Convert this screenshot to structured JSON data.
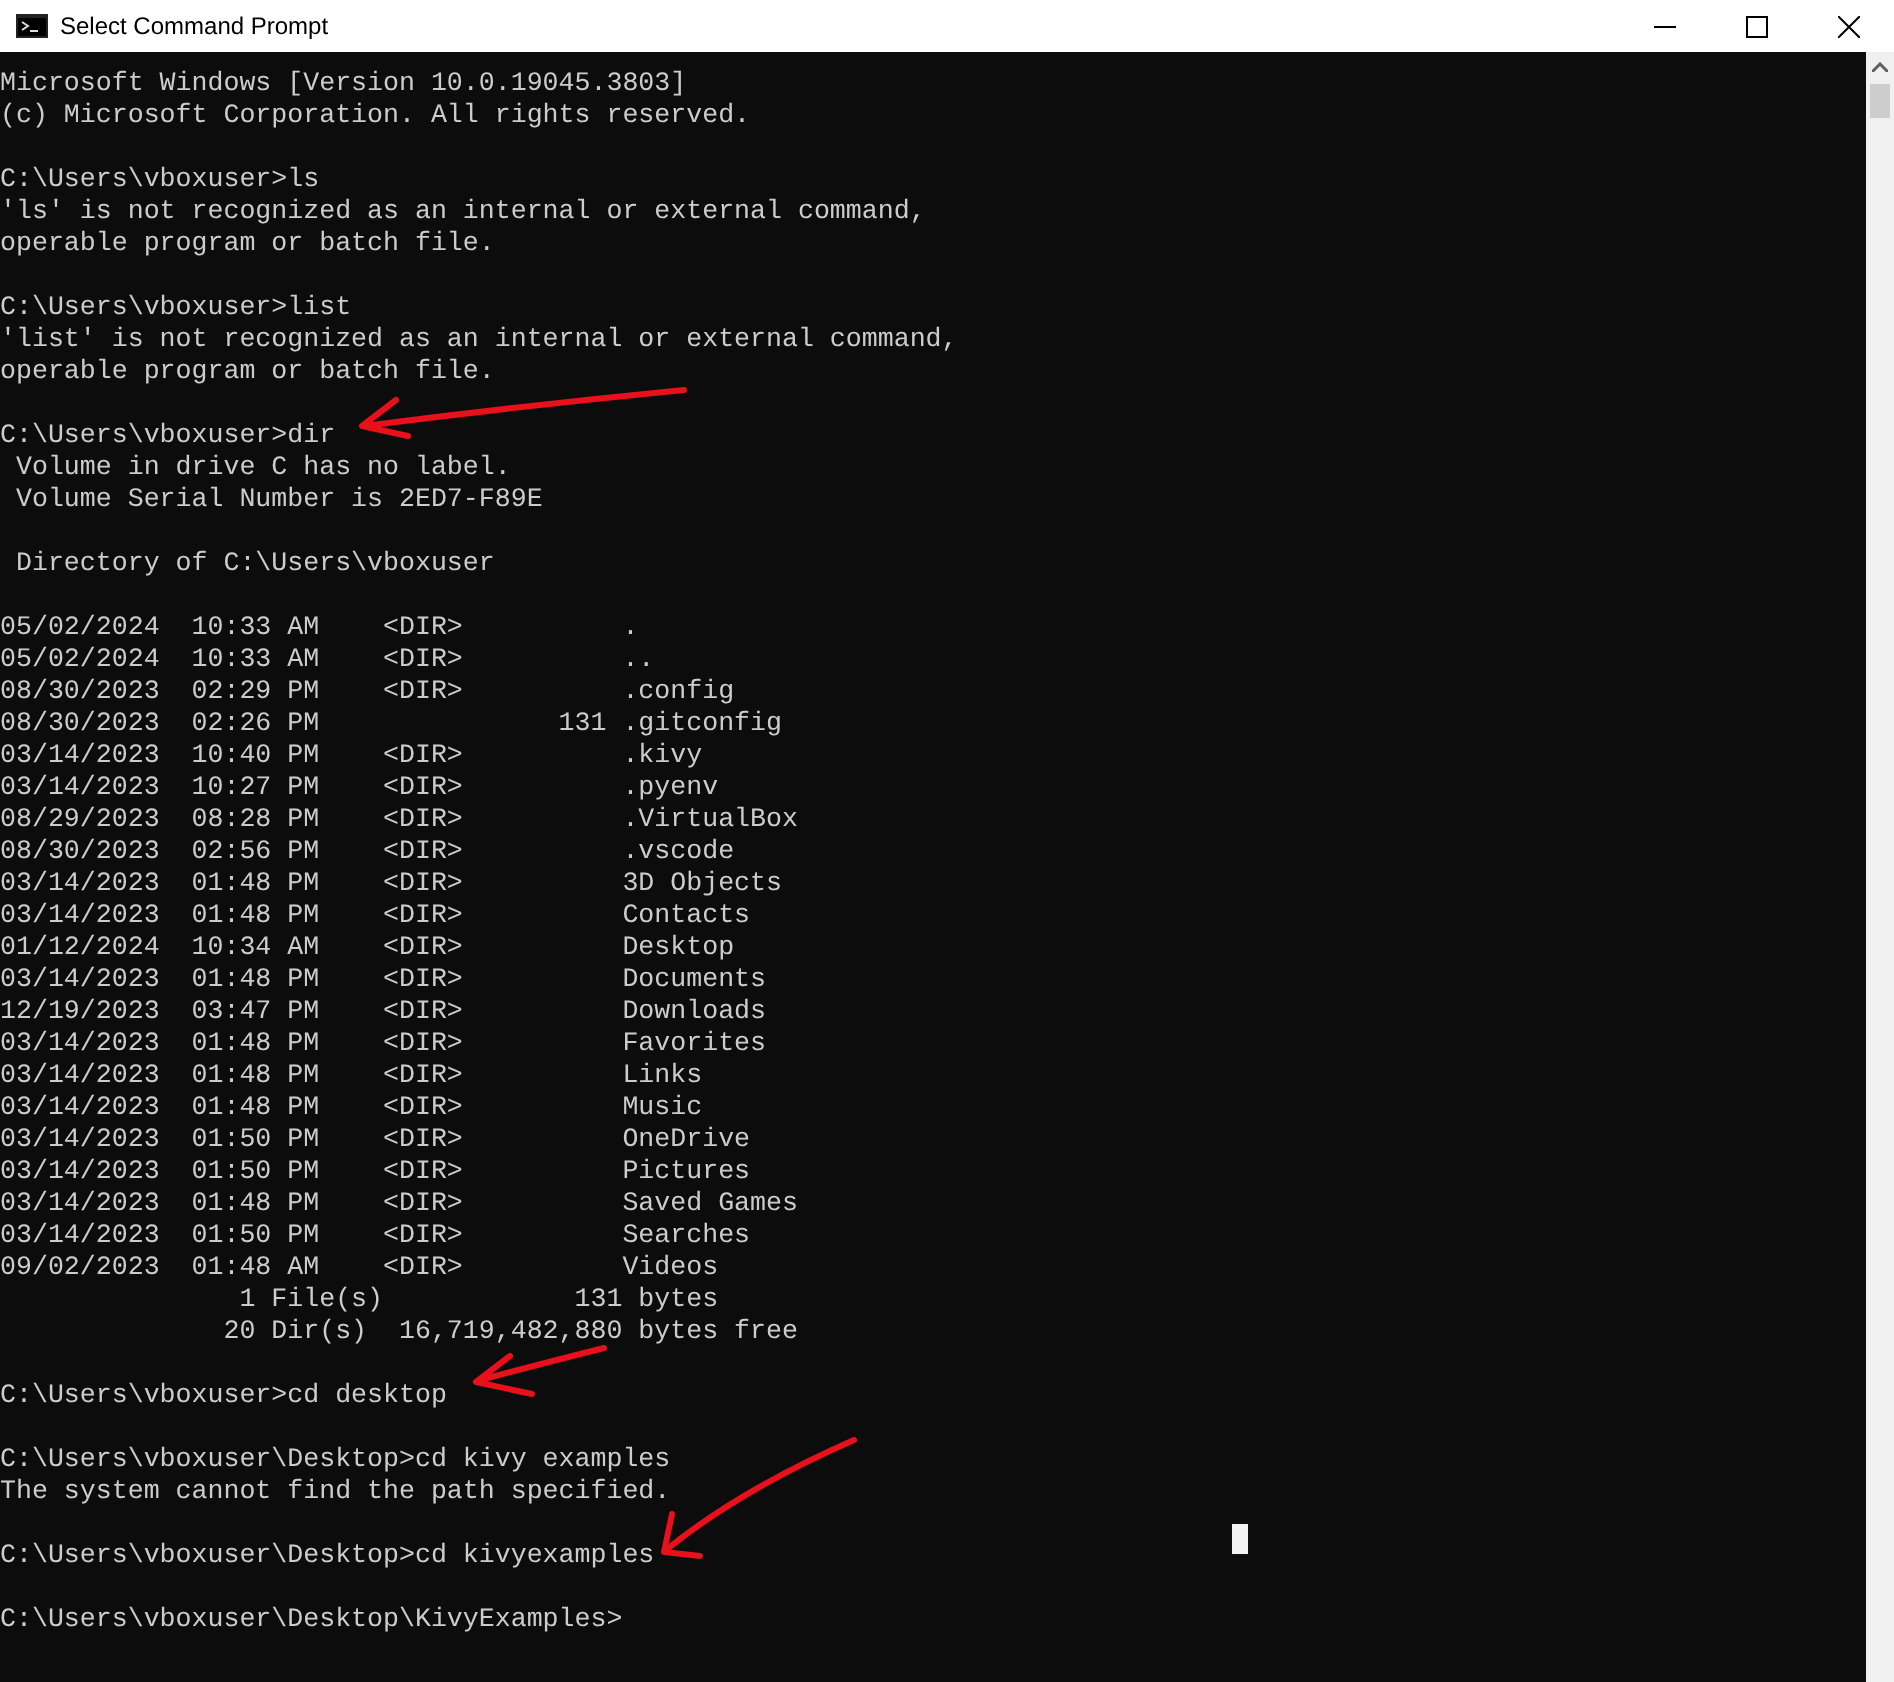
{
  "window": {
    "title": "Select Command Prompt"
  },
  "console": {
    "blocks": [
      [
        "Microsoft Windows [Version 10.0.19045.3803]",
        "(c) Microsoft Corporation. All rights reserved."
      ],
      [
        "C:\\Users\\vboxuser>ls",
        "'ls' is not recognized as an internal or external command,",
        "operable program or batch file."
      ],
      [
        "C:\\Users\\vboxuser>list",
        "'list' is not recognized as an internal or external command,",
        "operable program or batch file."
      ],
      [
        "C:\\Users\\vboxuser>dir",
        " Volume in drive C has no label.",
        " Volume Serial Number is 2ED7-F89E"
      ],
      [
        " Directory of C:\\Users\\vboxuser"
      ],
      [
        "05/02/2024  10:33 AM    <DIR>          .",
        "05/02/2024  10:33 AM    <DIR>          ..",
        "08/30/2023  02:29 PM    <DIR>          .config",
        "08/30/2023  02:26 PM               131 .gitconfig",
        "03/14/2023  10:40 PM    <DIR>          .kivy",
        "03/14/2023  10:27 PM    <DIR>          .pyenv",
        "08/29/2023  08:28 PM    <DIR>          .VirtualBox",
        "08/30/2023  02:56 PM    <DIR>          .vscode",
        "03/14/2023  01:48 PM    <DIR>          3D Objects",
        "03/14/2023  01:48 PM    <DIR>          Contacts",
        "01/12/2024  10:34 AM    <DIR>          Desktop",
        "03/14/2023  01:48 PM    <DIR>          Documents",
        "12/19/2023  03:47 PM    <DIR>          Downloads",
        "03/14/2023  01:48 PM    <DIR>          Favorites",
        "03/14/2023  01:48 PM    <DIR>          Links",
        "03/14/2023  01:48 PM    <DIR>          Music",
        "03/14/2023  01:50 PM    <DIR>          OneDrive",
        "03/14/2023  01:50 PM    <DIR>          Pictures",
        "03/14/2023  01:48 PM    <DIR>          Saved Games",
        "03/14/2023  01:50 PM    <DIR>          Searches",
        "09/02/2023  01:48 AM    <DIR>          Videos",
        "               1 File(s)            131 bytes",
        "              20 Dir(s)  16,719,482,880 bytes free"
      ],
      [
        "C:\\Users\\vboxuser>cd desktop"
      ],
      [
        "C:\\Users\\vboxuser\\Desktop>cd kivy examples",
        "The system cannot find the path specified."
      ],
      [
        "C:\\Users\\vboxuser\\Desktop>cd kivyexamples"
      ],
      [
        "C:\\Users\\vboxuser\\Desktop\\KivyExamples>"
      ]
    ]
  }
}
